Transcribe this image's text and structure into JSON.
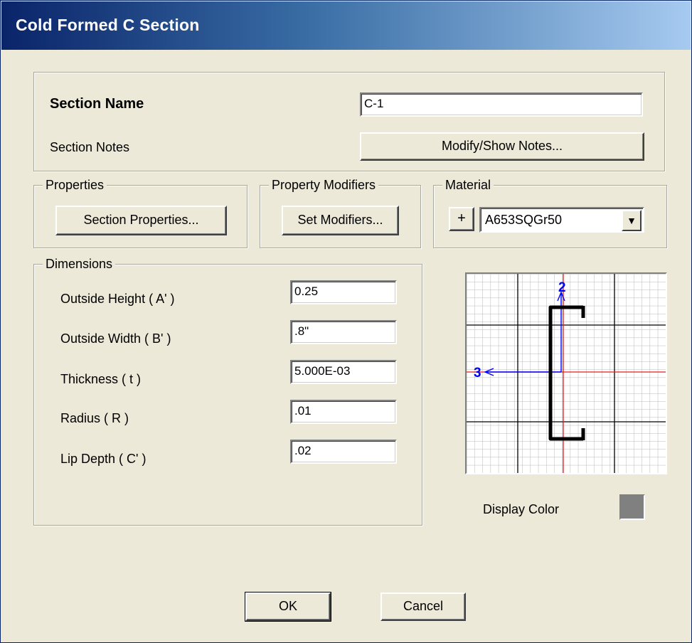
{
  "window": {
    "title": "Cold Formed C Section"
  },
  "section": {
    "name_label": "Section Name",
    "name_value": "C-1",
    "notes_label": "Section Notes",
    "notes_button": "Modify/Show Notes..."
  },
  "properties": {
    "legend": "Properties",
    "button": "Section Properties..."
  },
  "modifiers": {
    "legend": "Property Modifiers",
    "button": "Set Modifiers..."
  },
  "material": {
    "legend": "Material",
    "add_button": "+",
    "selected": "A653SQGr50"
  },
  "dimensions": {
    "legend": "Dimensions",
    "rows": [
      {
        "label": "Outside Height  ( A' )",
        "value": "0.25"
      },
      {
        "label": "Outside Width  ( B' )",
        "value": ".8\""
      },
      {
        "label": "Thickness  ( t )",
        "value": "5.000E-03"
      },
      {
        "label": "Radius  ( R )",
        "value": ".01"
      },
      {
        "label": "Lip Depth  ( C' )",
        "value": ".02"
      }
    ]
  },
  "preview": {
    "axis_2": "2",
    "axis_3": "3"
  },
  "display_color": {
    "label": "Display Color",
    "color": "#808080"
  },
  "buttons": {
    "ok": "OK",
    "cancel": "Cancel"
  }
}
